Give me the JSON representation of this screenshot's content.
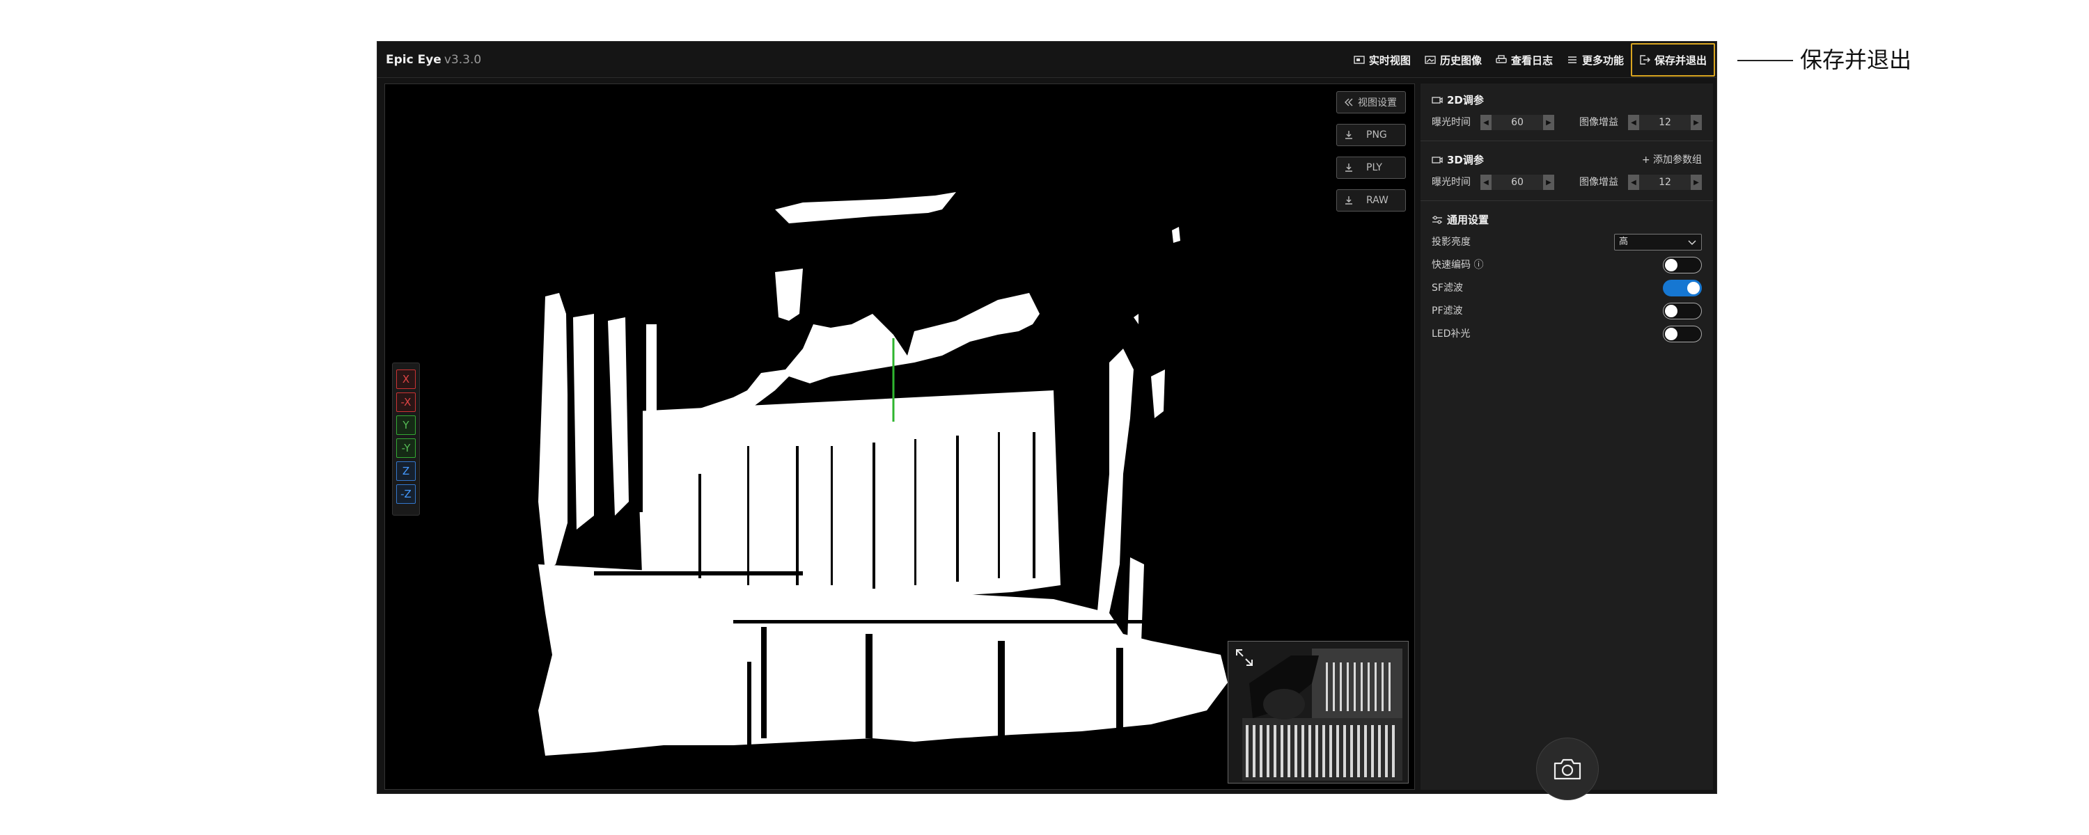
{
  "app": {
    "title": "Epic Eye",
    "version": "v3.3.0"
  },
  "nav": {
    "items": [
      {
        "label": "实时视图",
        "icon": "live-view-icon"
      },
      {
        "label": "历史图像",
        "icon": "history-image-icon"
      },
      {
        "label": "查看日志",
        "icon": "log-icon"
      },
      {
        "label": "更多功能",
        "icon": "menu-icon"
      },
      {
        "label": "保存并退出",
        "icon": "exit-icon"
      }
    ],
    "active_index": 4,
    "active_color": "#d9a520"
  },
  "viewer": {
    "settings_label": "视图设置",
    "exports": [
      {
        "label": "PNG"
      },
      {
        "label": "PLY"
      },
      {
        "label": "RAW"
      }
    ],
    "axes": [
      "X",
      "-X",
      "Y",
      "-Y",
      "Z",
      "-Z"
    ]
  },
  "panel": {
    "section_2d": {
      "title": "2D调参",
      "exposure_label": "曝光时间",
      "exposure_value": "60",
      "gain_label": "图像增益",
      "gain_value": "12"
    },
    "section_3d": {
      "title": "3D调参",
      "add_group_label": "添加参数组",
      "exposure_label": "曝光时间",
      "exposure_value": "60",
      "gain_label": "图像增益",
      "gain_value": "12"
    },
    "section_general": {
      "title": "通用设置",
      "projection_label": "投影亮度",
      "projection_value": "高",
      "toggles": [
        {
          "label": "快速编码 ⓘ",
          "on": false
        },
        {
          "label": "SF滤波",
          "on": true
        },
        {
          "label": "PF滤波",
          "on": false
        },
        {
          "label": "LED补光",
          "on": false
        }
      ]
    },
    "capture_icon": "camera-icon"
  },
  "callout": {
    "text": "保存并退出"
  },
  "colors": {
    "accent": "#d9a520",
    "toggle_on": "#1677d2",
    "axis_x": "#dd4444",
    "axis_y": "#55bb55",
    "axis_z": "#4499ff"
  }
}
